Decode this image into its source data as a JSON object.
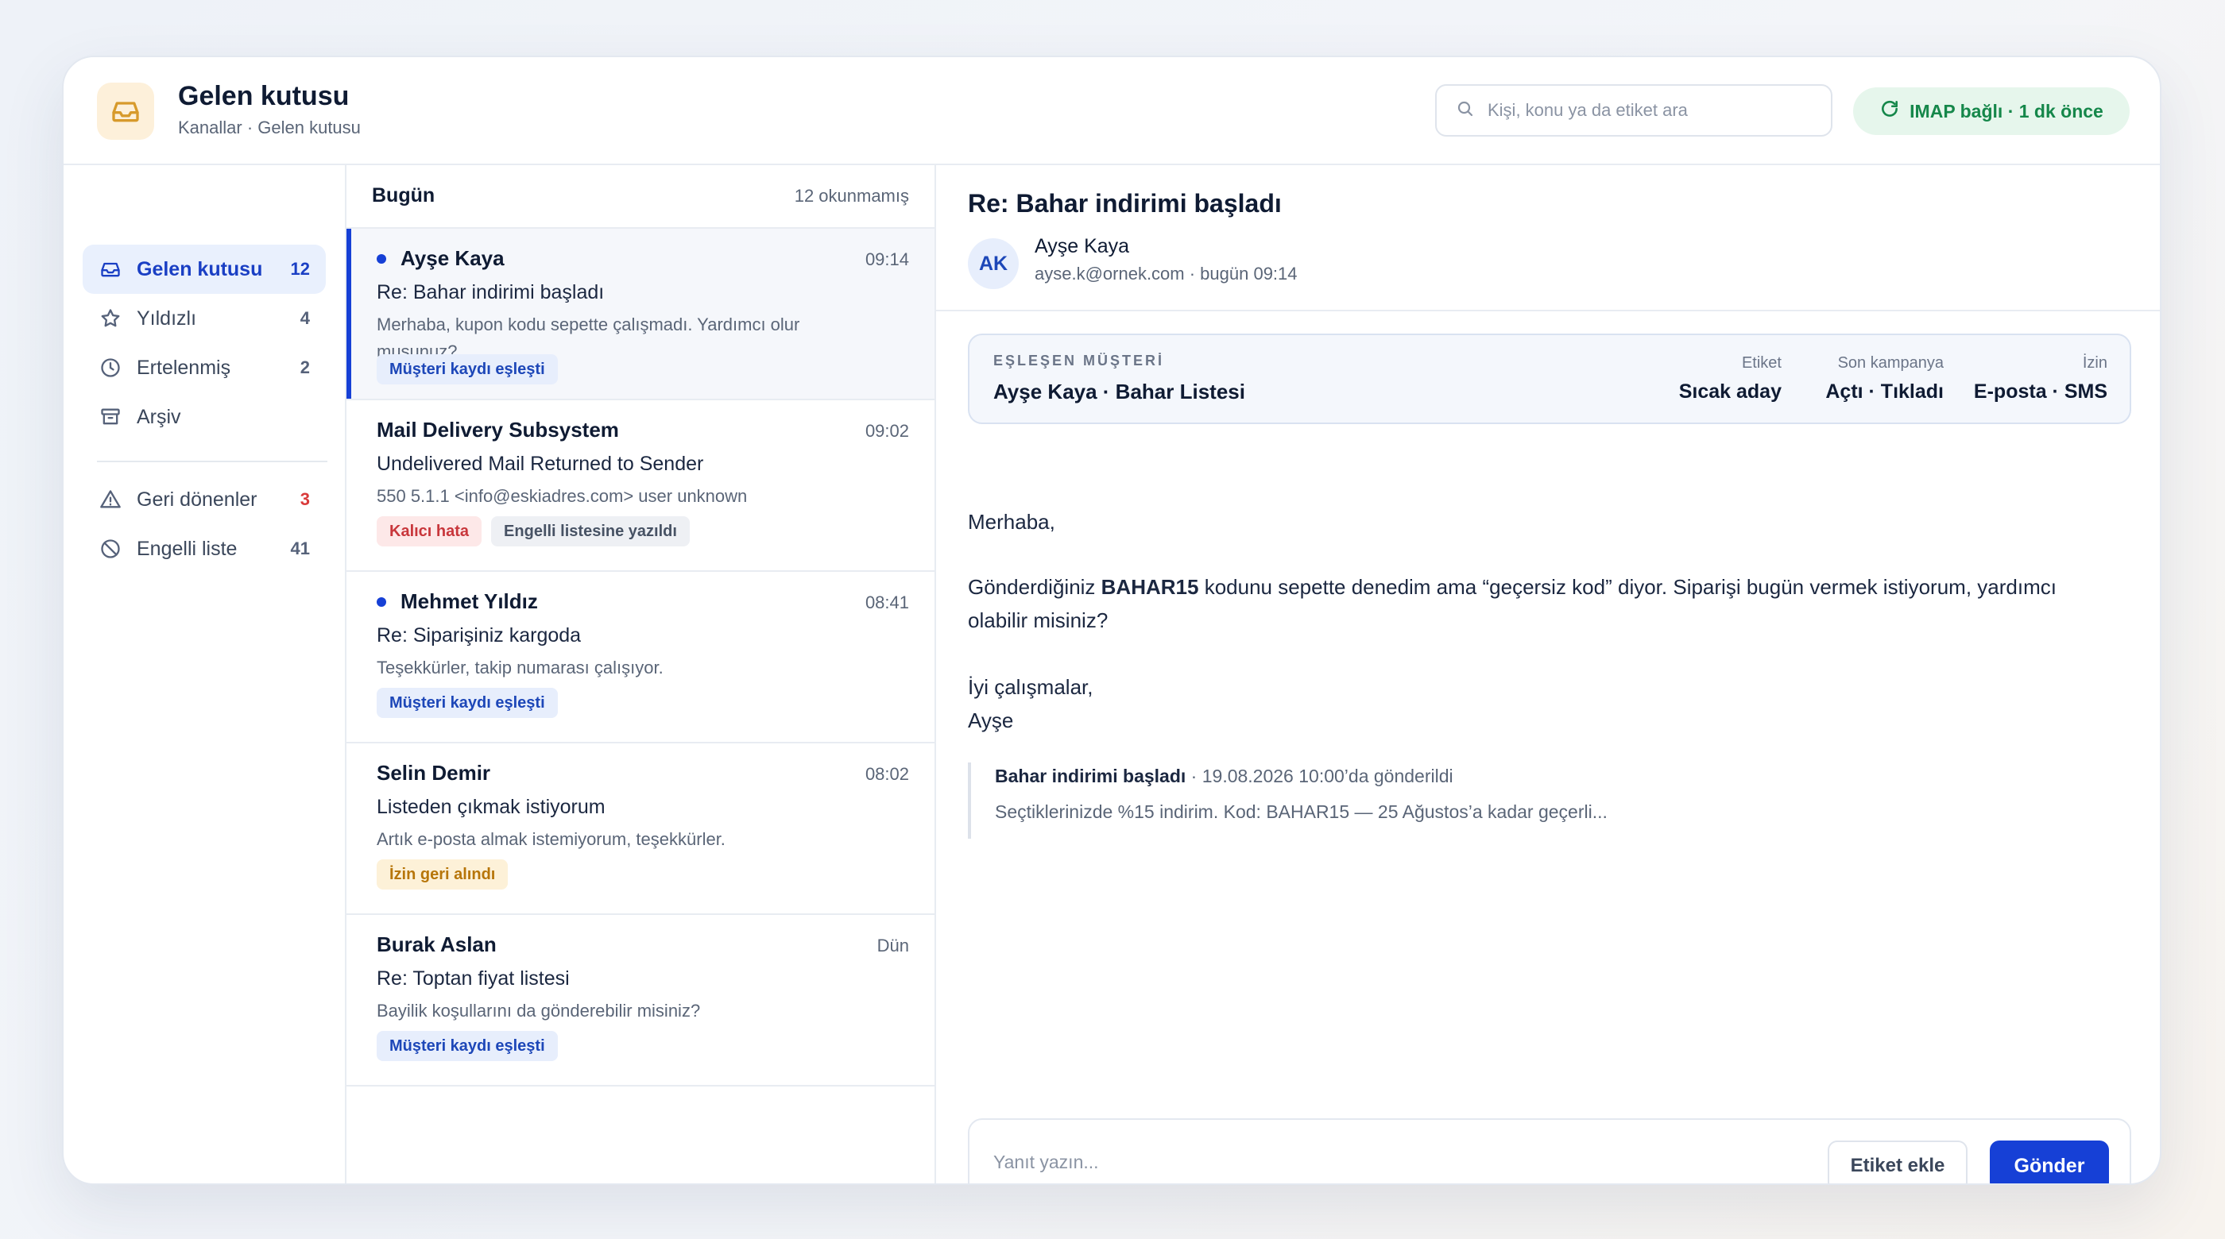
{
  "header": {
    "title": "Gelen kutusu",
    "breadcrumb": "Kanallar · Gelen kutusu",
    "search_placeholder": "Kişi, konu ya da etiket ara",
    "imap_status": "IMAP bağlı · 1 dk önce"
  },
  "sidebar": {
    "items": [
      {
        "label": "Gelen kutusu",
        "count": "12",
        "icon": "inbox-icon"
      },
      {
        "label": "Yıldızlı",
        "count": "4",
        "icon": "star-icon"
      },
      {
        "label": "Ertelenmiş",
        "count": "2",
        "icon": "clock-icon"
      },
      {
        "label": "Arşiv",
        "count": "",
        "icon": "archive-icon"
      },
      {
        "label": "Geri dönenler",
        "count": "3",
        "icon": "warning-icon"
      },
      {
        "label": "Engelli liste",
        "count": "41",
        "icon": "block-icon"
      }
    ]
  },
  "list": {
    "day": "Bugün",
    "unread": "12 okunmamış",
    "messages": [
      {
        "sender": "Ayşe Kaya",
        "time": "09:14",
        "subject": "Re: Bahar indirimi başladı",
        "preview": "Merhaba, kupon kodu sepette çalışmadı. Yardımcı olur musunuz?",
        "tags": [
          "Müşteri kaydı eşleşti"
        ],
        "unread": true
      },
      {
        "sender": "Mail Delivery Subsystem",
        "time": "09:02",
        "subject": "Undelivered Mail Returned to Sender",
        "preview": "550 5.1.1 <info@eskiadres.com> user unknown",
        "tags": [
          "Kalıcı hata",
          "Engelli listesine yazıldı"
        ],
        "unread": false
      },
      {
        "sender": "Mehmet Yıldız",
        "time": "08:41",
        "subject": "Re: Siparişiniz kargoda",
        "preview": "Teşekkürler, takip numarası çalışıyor.",
        "tags": [
          "Müşteri kaydı eşleşti"
        ],
        "unread": true
      },
      {
        "sender": "Selin Demir",
        "time": "08:02",
        "subject": "Listeden çıkmak istiyorum",
        "preview": "Artık e-posta almak istemiyorum, teşekkürler.",
        "tags": [
          "İzin geri alındı"
        ],
        "unread": false
      },
      {
        "sender": "Burak Aslan",
        "time": "Dün",
        "subject": "Re: Toptan fiyat listesi",
        "preview": "Bayilik koşullarını da gönderebilir misiniz?",
        "tags": [
          "Müşteri kaydı eşleşti"
        ],
        "unread": false
      }
    ]
  },
  "pane": {
    "subject": "Re: Bahar indirimi başladı",
    "avatar_initials": "AK",
    "from_name": "Ayşe Kaya",
    "from_meta": "ayse.k@ornek.com · bugün 09:14",
    "match": {
      "kicker": "EŞLEŞEN MÜŞTERİ",
      "name": "Ayşe Kaya · Bahar Listesi",
      "fields": [
        {
          "key": "Etiket",
          "value": "Sıcak aday"
        },
        {
          "key": "Son kampanya",
          "value": "Açtı · Tıkladı"
        },
        {
          "key": "İzin",
          "value": "E-posta · SMS"
        }
      ]
    },
    "body": {
      "greeting": "Merhaba,",
      "p1_before": "Gönderdiğiniz ",
      "p1_code": "BAHAR15",
      "p1_after": " kodunu sepette denedim ama “geçersiz kod” diyor. Siparişi bugün vermek istiyorum, yardımcı",
      "p1_line2": "olabilir misiniz?",
      "closing": "İyi çalışmalar,",
      "signature": "Ayşe"
    },
    "quote": {
      "title": "Bahar indirimi başladı",
      "meta": " · 19.08.2026 10:00’da gönderildi",
      "text": "Seçtiklerinizde %15 indirim. Kod: BAHAR15 — 25 Ağustos’a kadar geçerli..."
    },
    "reply": {
      "placeholder": "Yanıt yazın...",
      "tag_button": "Etiket ekle",
      "send_button": "Gönder"
    }
  },
  "colors": {
    "accent": "#1640d6",
    "success": "#15874a",
    "danger": "#c8363b",
    "warning": "#b77509"
  }
}
